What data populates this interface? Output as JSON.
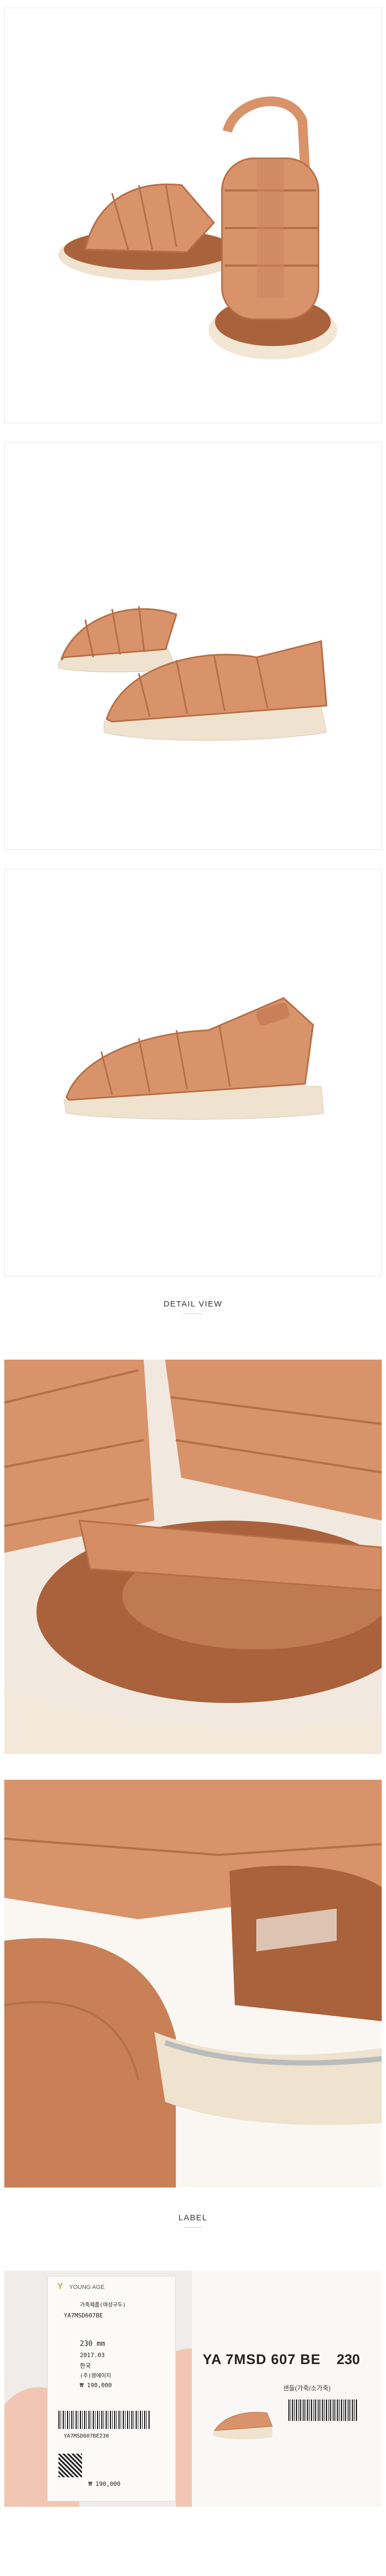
{
  "sections": {
    "detail_title": "DETAIL VIEW",
    "label_title": "LABEL"
  },
  "tag": {
    "brand": "YOUNG AGE",
    "line1": "가죽제품(여성구두)",
    "model": "YA7MSD607BE",
    "size": "230 mm",
    "date": "2017.03",
    "origin": "한국",
    "maker": "(주)영에이지",
    "price": "₩ 190,000",
    "barcode_text": "YA7MSD607BE230",
    "price_bottom": "₩ 190,000"
  },
  "box_label": {
    "model": "YA 7MSD 607 BE",
    "size": "230",
    "desc": "샌들(가죽/소가죽)"
  },
  "colors": {
    "leather": "#d8936a",
    "leather_dark": "#b56f47",
    "sole": "#efe3cf",
    "insole": "#a9623c"
  }
}
